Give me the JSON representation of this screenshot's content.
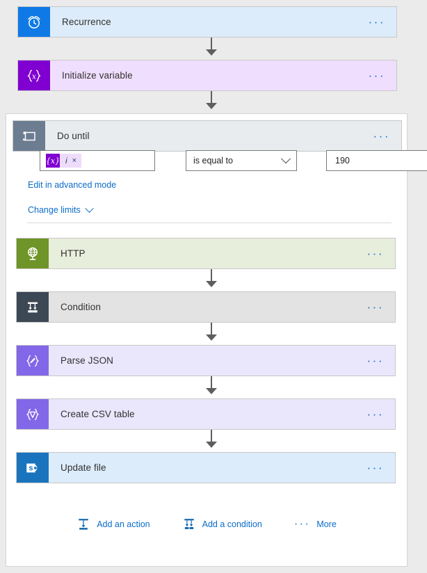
{
  "flow": {
    "trigger": {
      "label": "Recurrence",
      "icon": "alarm-clock-icon",
      "icon_color": "#0f7ae5",
      "card_color": "#dcecfb",
      "menu": "···"
    },
    "steps": [
      {
        "label": "Initialize variable",
        "icon": "braces-x-icon",
        "icon_color": "#8000d1",
        "card_color": "#f0deff",
        "menu": "···"
      }
    ],
    "scope": {
      "label": "Do until",
      "icon": "loop-icon",
      "icon_color": "#6c7d91",
      "card_color": "#e8ecef",
      "menu": "···",
      "condition": {
        "token": {
          "icon_label": "{x}",
          "text": "i",
          "close": "×"
        },
        "operator": "is equal to",
        "operator_icon": "chevron-down-icon",
        "value": "190"
      },
      "links": {
        "advanced": "Edit in advanced mode",
        "limits": "Change limits",
        "limits_icon": "chevron-down-icon"
      },
      "children": [
        {
          "label": "HTTP",
          "icon": "globe-icon",
          "icon_color": "#6f9427",
          "card_color": "#e8eedc",
          "menu": "···"
        },
        {
          "label": "Condition",
          "icon": "condition-branch-icon",
          "icon_color": "#3d4855",
          "card_color": "#e3e3e3",
          "menu": "···"
        },
        {
          "label": "Parse JSON",
          "icon": "braces-pencil-icon",
          "icon_color": "#8267e8",
          "card_color": "#eae6fc",
          "menu": "···"
        },
        {
          "label": "Create CSV table",
          "icon": "braces-funnel-icon",
          "icon_color": "#8267e8",
          "card_color": "#eae6fc",
          "menu": "···"
        },
        {
          "label": "Update file",
          "icon": "sharepoint-icon",
          "icon_color": "#1a74bd",
          "card_color": "#dcecfb",
          "menu": "···"
        }
      ],
      "action_bar": {
        "add_action": "Add an action",
        "add_action_icon": "add-action-icon",
        "add_condition": "Add a condition",
        "add_condition_icon": "add-condition-icon",
        "more": "More",
        "more_icon": "ellipsis-icon",
        "more_dots": "···"
      }
    }
  }
}
